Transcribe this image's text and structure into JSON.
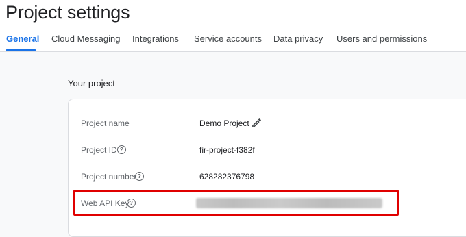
{
  "page": {
    "title": "Project settings"
  },
  "tabs": [
    {
      "label": "General",
      "active": true
    },
    {
      "label": "Cloud Messaging"
    },
    {
      "label": "Integrations"
    },
    {
      "label": "Service accounts"
    },
    {
      "label": "Data privacy"
    },
    {
      "label": "Users and permissions"
    }
  ],
  "section": {
    "heading": "Your project"
  },
  "fields": {
    "project_name": {
      "label": "Project name",
      "value": "Demo Project"
    },
    "project_id": {
      "label": "Project ID",
      "value": "fir-project-f382f"
    },
    "project_number": {
      "label": "Project number",
      "value": "628282376798"
    },
    "web_api_key": {
      "label": "Web API Key"
    }
  },
  "icons": {
    "help": "help-circle-icon",
    "edit": "pencil-icon"
  },
  "colors": {
    "accent": "#1a73e8",
    "highlight": "#e00000"
  }
}
